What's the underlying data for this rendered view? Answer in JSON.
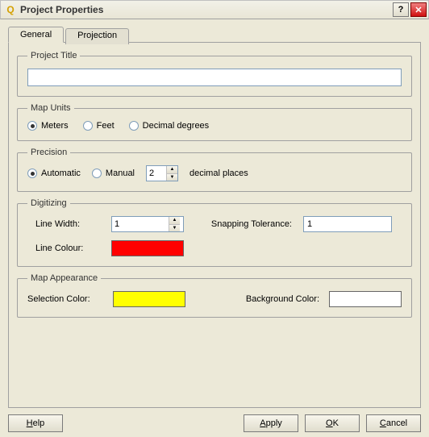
{
  "window": {
    "title": "Project Properties"
  },
  "tabs": [
    {
      "label": "General"
    },
    {
      "label": "Projection"
    }
  ],
  "general": {
    "project_title": {
      "legend": "Project Title",
      "value": ""
    },
    "map_units": {
      "legend": "Map Units",
      "options": {
        "meters": "Meters",
        "feet": "Feet",
        "decimal": "Decimal degrees"
      },
      "selected": "meters"
    },
    "precision": {
      "legend": "Precision",
      "options": {
        "automatic": "Automatic",
        "manual": "Manual"
      },
      "selected": "automatic",
      "decimal_value": "2",
      "suffix": "decimal places"
    },
    "digitizing": {
      "legend": "Digitizing",
      "line_width_label": "Line Width:",
      "line_width_value": "1",
      "snapping_label": "Snapping Tolerance:",
      "snapping_value": "1",
      "line_colour_label": "Line Colour:",
      "line_colour_value": "#ff0000"
    },
    "map_appearance": {
      "legend": "Map Appearance",
      "selection_color_label": "Selection Color:",
      "selection_color_value": "#ffff00",
      "background_color_label": "Background Color:",
      "background_color_value": "#ffffff"
    }
  },
  "buttons": {
    "help": "Help",
    "apply": "Apply",
    "ok": "OK",
    "cancel": "Cancel"
  }
}
